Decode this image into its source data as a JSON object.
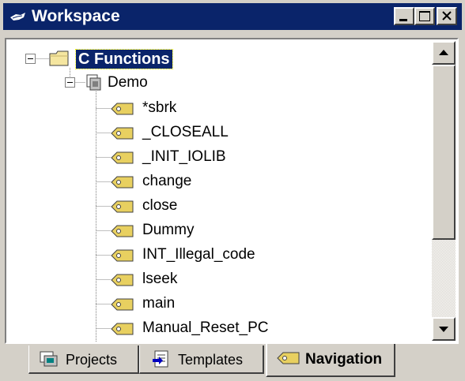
{
  "window": {
    "title": "Workspace",
    "colors": {
      "titlebar": "#0a246a",
      "face": "#d4d0c8",
      "selection": "#0a246a"
    }
  },
  "tree": {
    "root": {
      "label": "C Functions",
      "icon": "folder-icon",
      "expanded": true,
      "selected": true
    },
    "project": {
      "label": "Demo",
      "icon": "project-icon",
      "expanded": true
    },
    "items": [
      {
        "label": "*sbrk",
        "icon": "function-tag-icon"
      },
      {
        "label": "_CLOSEALL",
        "icon": "function-tag-icon"
      },
      {
        "label": "_INIT_IOLIB",
        "icon": "function-tag-icon"
      },
      {
        "label": "change",
        "icon": "function-tag-icon"
      },
      {
        "label": "close",
        "icon": "function-tag-icon"
      },
      {
        "label": "Dummy",
        "icon": "function-tag-icon"
      },
      {
        "label": "INT_Illegal_code",
        "icon": "function-tag-icon"
      },
      {
        "label": "lseek",
        "icon": "function-tag-icon"
      },
      {
        "label": "main",
        "icon": "function-tag-icon"
      },
      {
        "label": "Manual_Reset_PC",
        "icon": "function-tag-icon"
      }
    ]
  },
  "tabs": [
    {
      "label": "Projects",
      "icon": "projects-icon",
      "active": false
    },
    {
      "label": "Templates",
      "icon": "templates-icon",
      "active": false
    },
    {
      "label": "Navigation",
      "icon": "navigation-icon",
      "active": true
    }
  ]
}
